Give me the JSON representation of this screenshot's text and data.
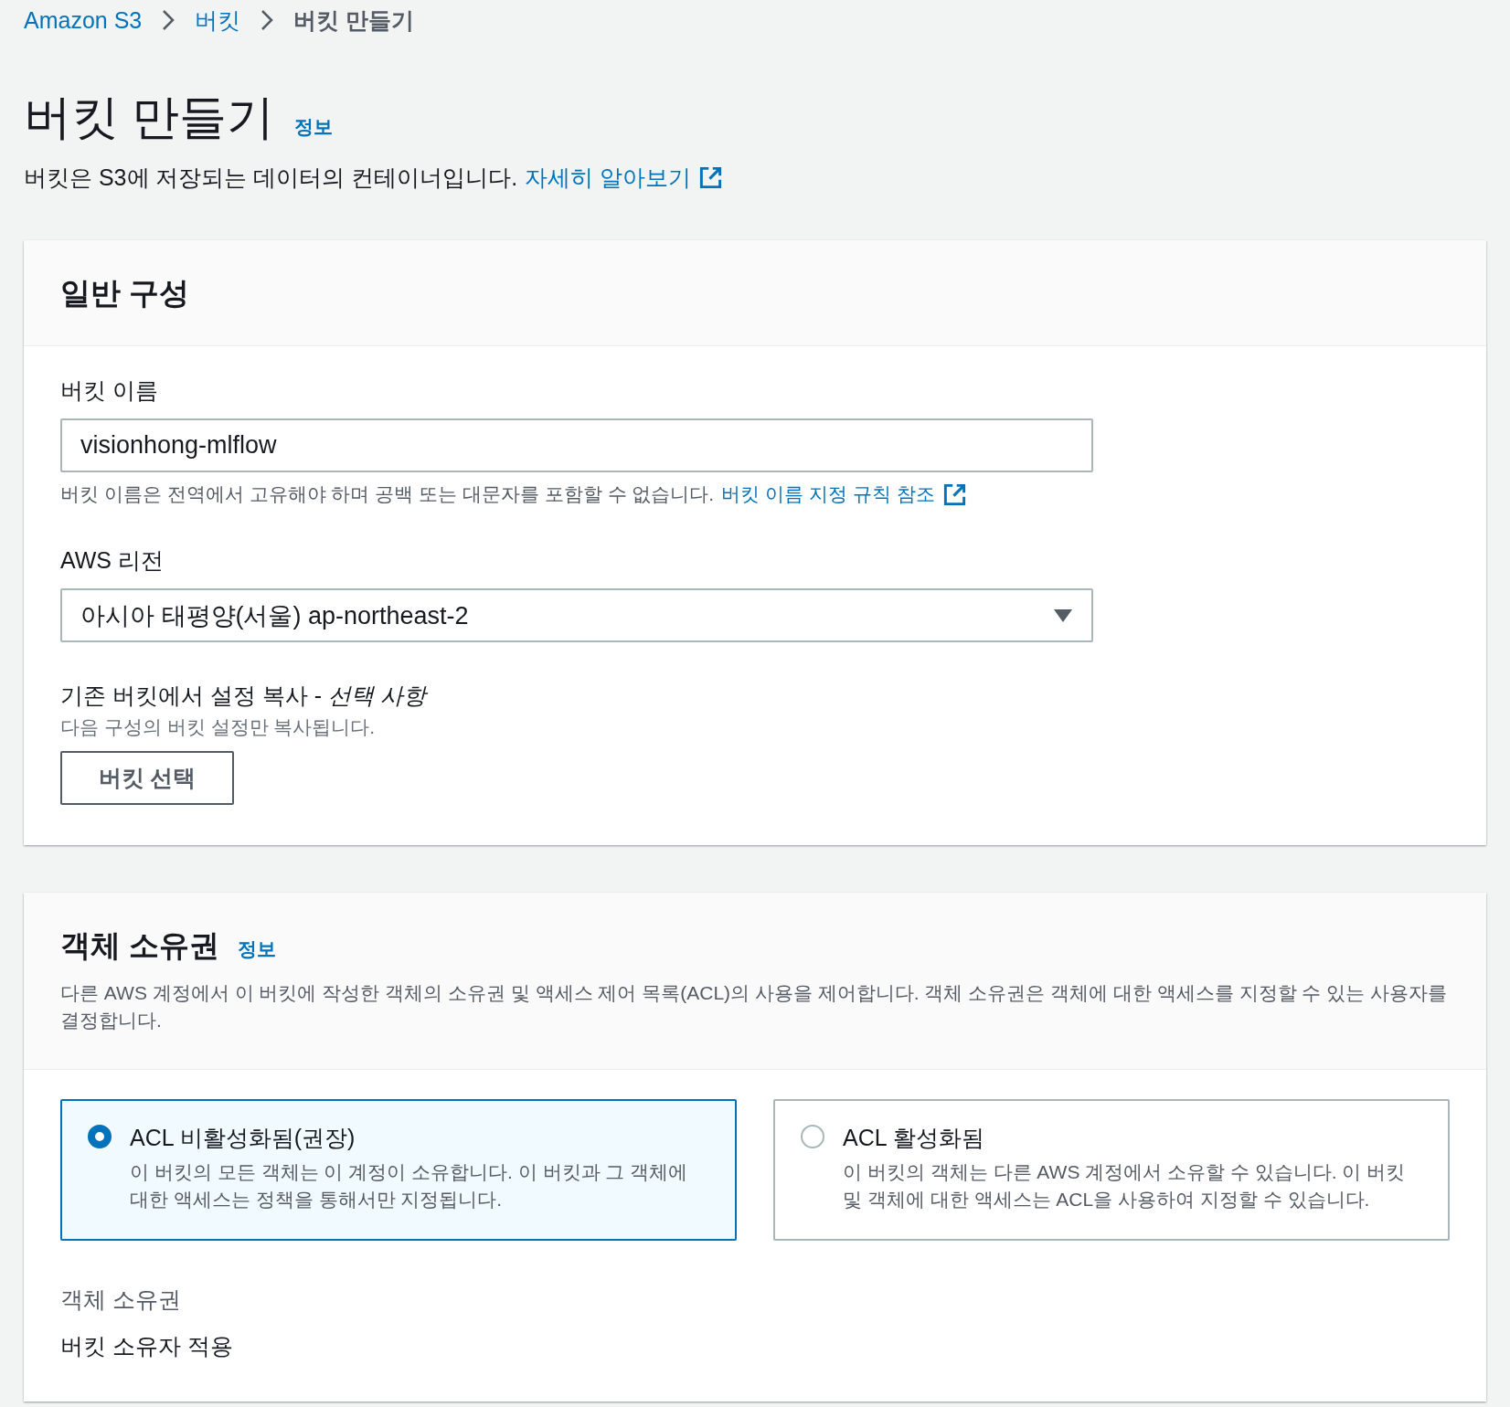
{
  "breadcrumbs": [
    {
      "label": "Amazon S3",
      "selected": false
    },
    {
      "label": "버킷",
      "selected": false
    },
    {
      "label": "버킷 만들기",
      "selected": true
    }
  ],
  "header": {
    "title": "버킷 만들기",
    "info_link": "정보",
    "description": "버킷은 S3에 저장되는 데이터의 컨테이너입니다.",
    "learn_more_link": "자세히 알아보기"
  },
  "general": {
    "heading": "일반 구성",
    "bucket_name": {
      "label": "버킷 이름",
      "value": "visionhong-mlflow",
      "hint": "버킷 이름은 전역에서 고유해야 하며 공백 또는 대문자를 포함할 수 없습니다.",
      "hint_link": "버킷 이름 지정 규칙 참조"
    },
    "region": {
      "label": "AWS 리전",
      "value": "아시아 태평양(서울) ap-northeast-2"
    },
    "copy": {
      "label": "기존 버킷에서 설정 복사 - *선택 사항*",
      "hint": "다음 구성의 버킷 설정만 복사됩니다.",
      "button": "버킷 선택"
    }
  },
  "ownership": {
    "heading": "객체 소유권",
    "info_link": "정보",
    "description": "다른 AWS 계정에서 이 버킷에 작성한 객체의 소유권 및 액세스 제어 목록(ACL)의 사용을 제어합니다. 객체 소유권은 객체에 대한 액세스를 지정할 수 있는 사용자를 결정합니다.",
    "options": [
      {
        "title": "ACL 비활성화됨(권장)",
        "description": "이 버킷의 모든 객체는 이 계정이 소유합니다. 이 버킷과 그 객체에 대한 액세스는 정책을 통해서만 지정됩니다.",
        "selected": true
      },
      {
        "title": "ACL 활성화됨",
        "description": "이 버킷의 객체는 다른 AWS 계정에서 소유할 수 있습니다. 이 버킷 및 객체에 대한 액세스는 ACL을 사용하여 지정할 수 있습니다.",
        "selected": false
      }
    ],
    "ownership_label": "객체 소유권",
    "ownership_value": "버킷 소유자 적용"
  }
}
